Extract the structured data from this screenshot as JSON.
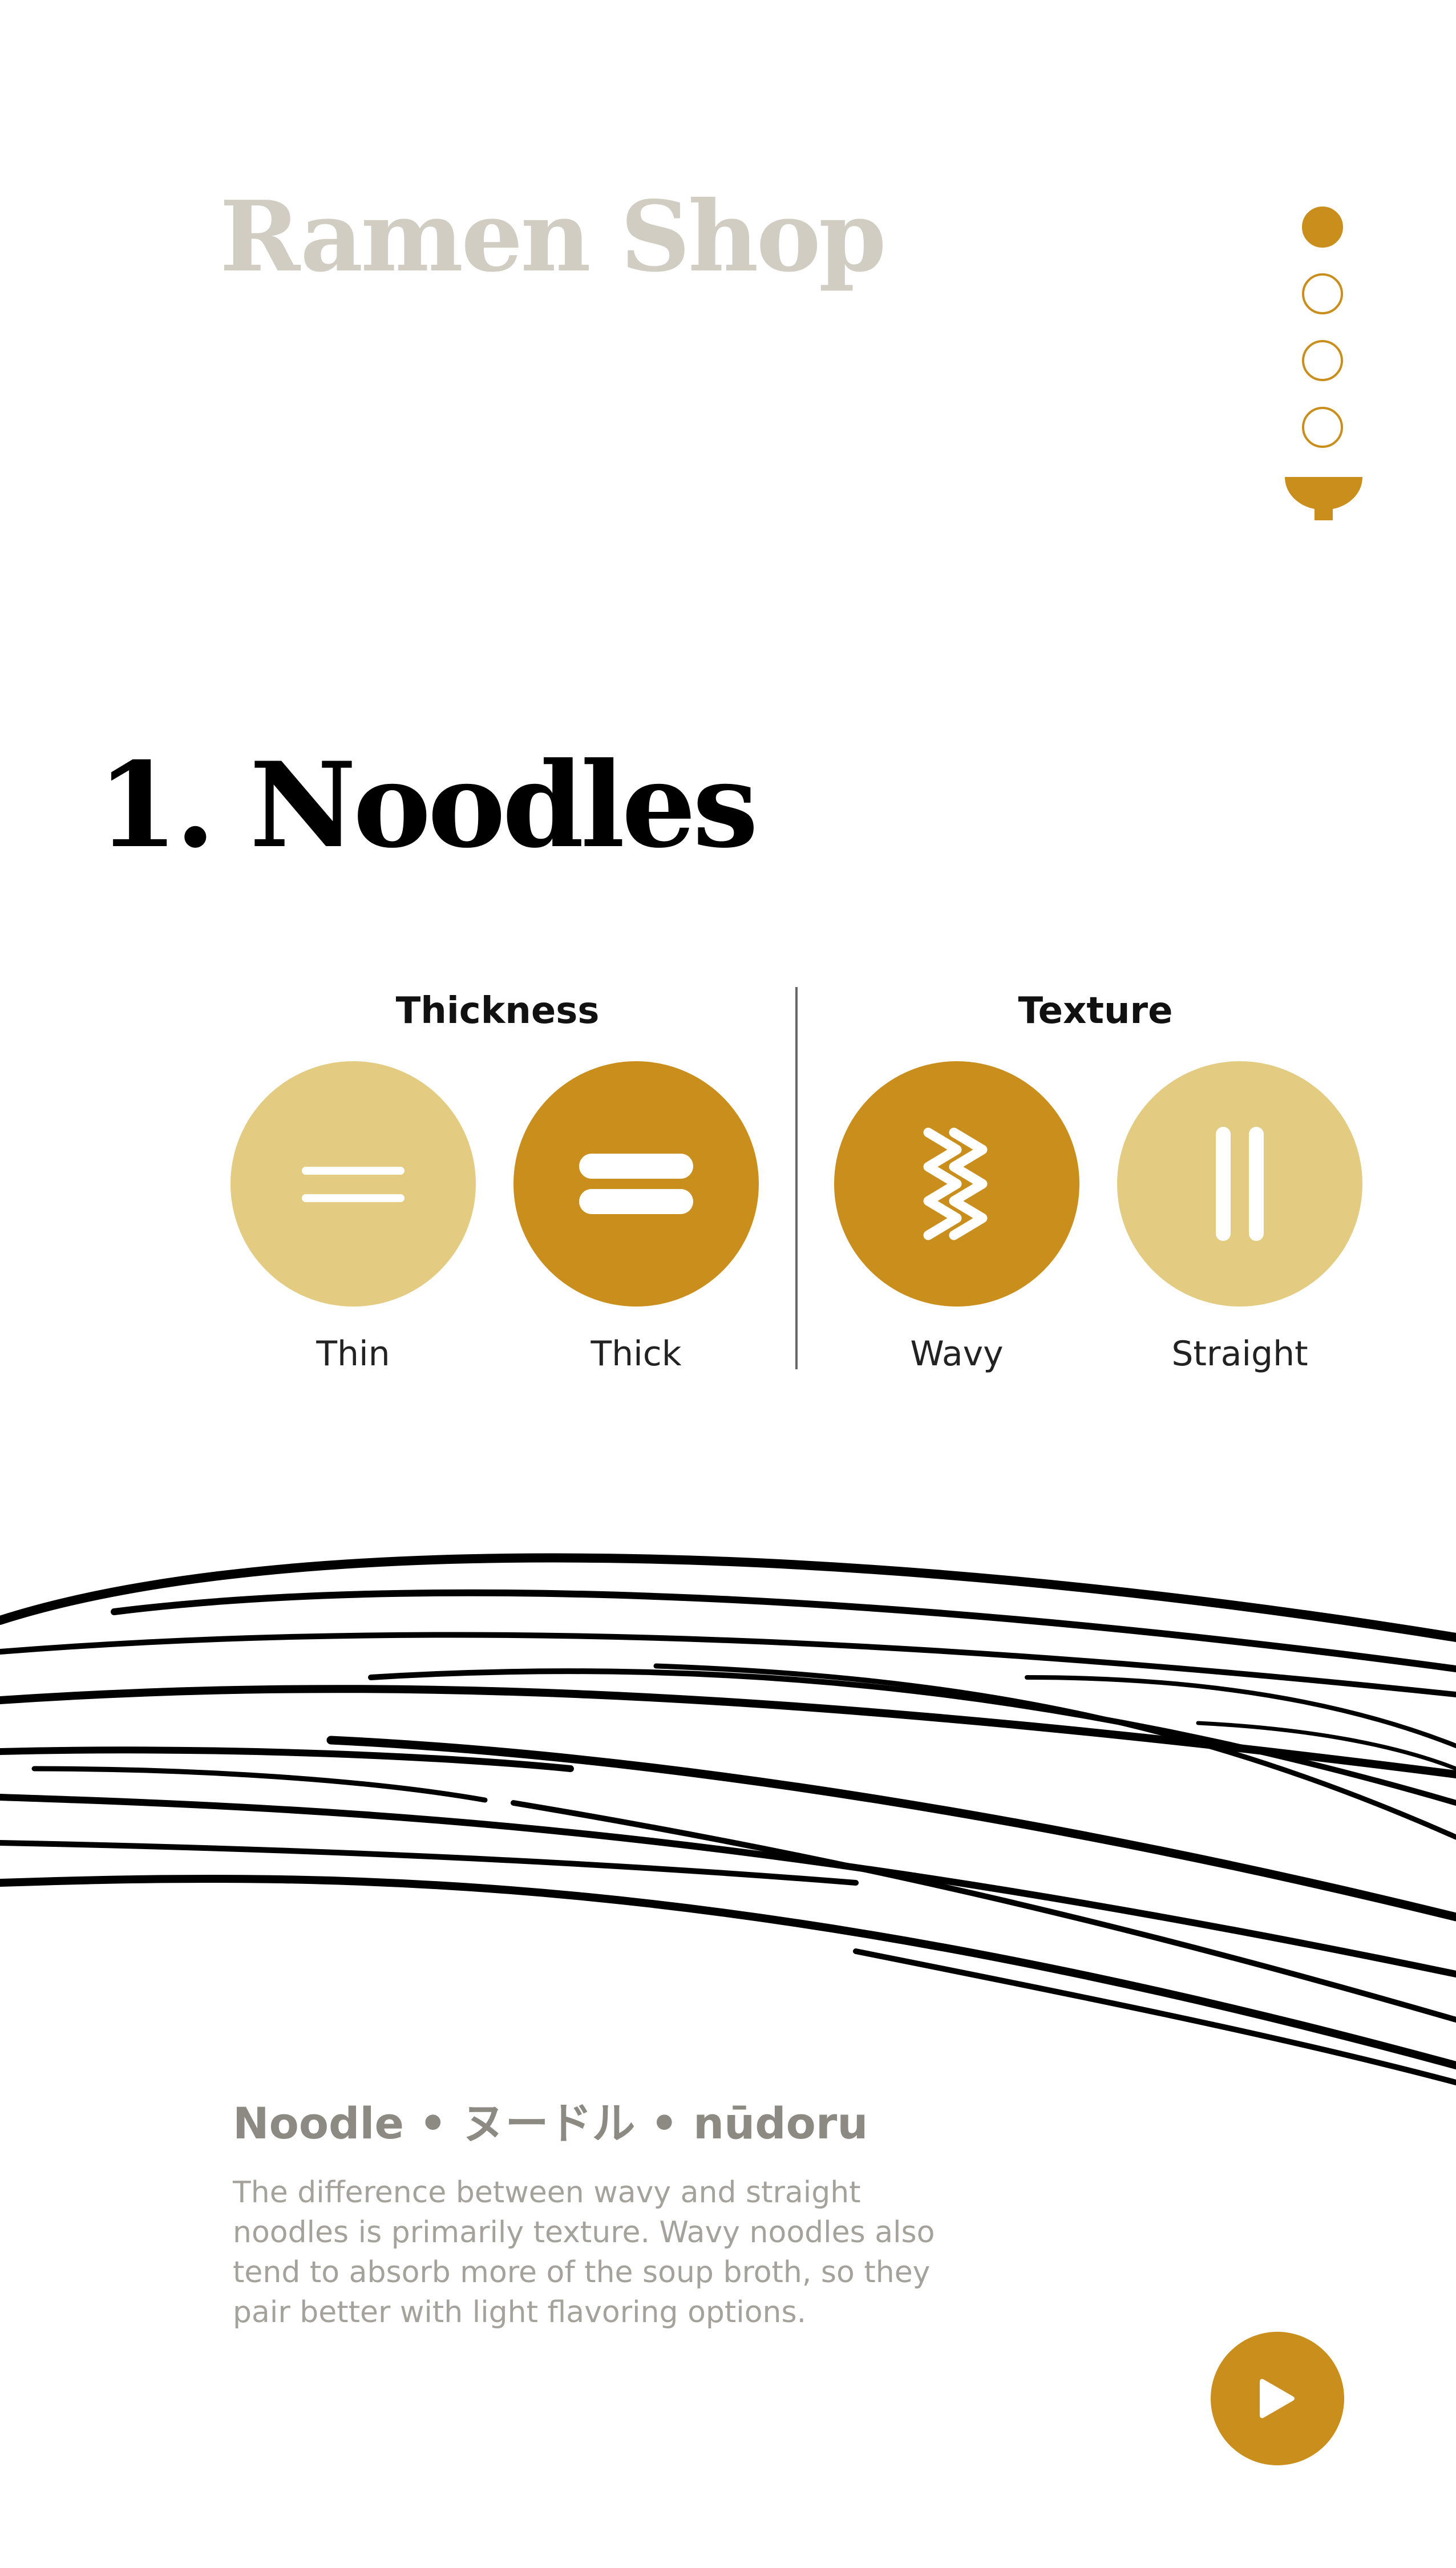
{
  "app": {
    "title": "Ramen Shop"
  },
  "progress": {
    "total_steps": 4,
    "current_step": 1,
    "end_icon": "bowl-icon"
  },
  "section": {
    "title": "1. Noodles"
  },
  "groups": {
    "thickness": {
      "title": "Thickness",
      "options": [
        {
          "label": "Thin",
          "icon": "thin-lines-icon",
          "selected": false
        },
        {
          "label": "Thick",
          "icon": "thick-lines-icon",
          "selected": true
        }
      ]
    },
    "texture": {
      "title": "Texture",
      "options": [
        {
          "label": "Wavy",
          "icon": "wavy-lines-icon",
          "selected": true
        },
        {
          "label": "Straight",
          "icon": "straight-lines-icon",
          "selected": false
        }
      ]
    }
  },
  "info": {
    "term": "Noodle • ヌードル • nūdoru",
    "description": "The difference between wavy and straight noodles is primarily texture. Wavy noodles also tend to absorb more of the soup broth, so they pair better with light flavoring options."
  },
  "actions": {
    "next_icon": "play-icon"
  },
  "colors": {
    "accent": "#c98e1b",
    "accent_light": "#e3cc82",
    "brand_text": "#d1cdc3"
  }
}
